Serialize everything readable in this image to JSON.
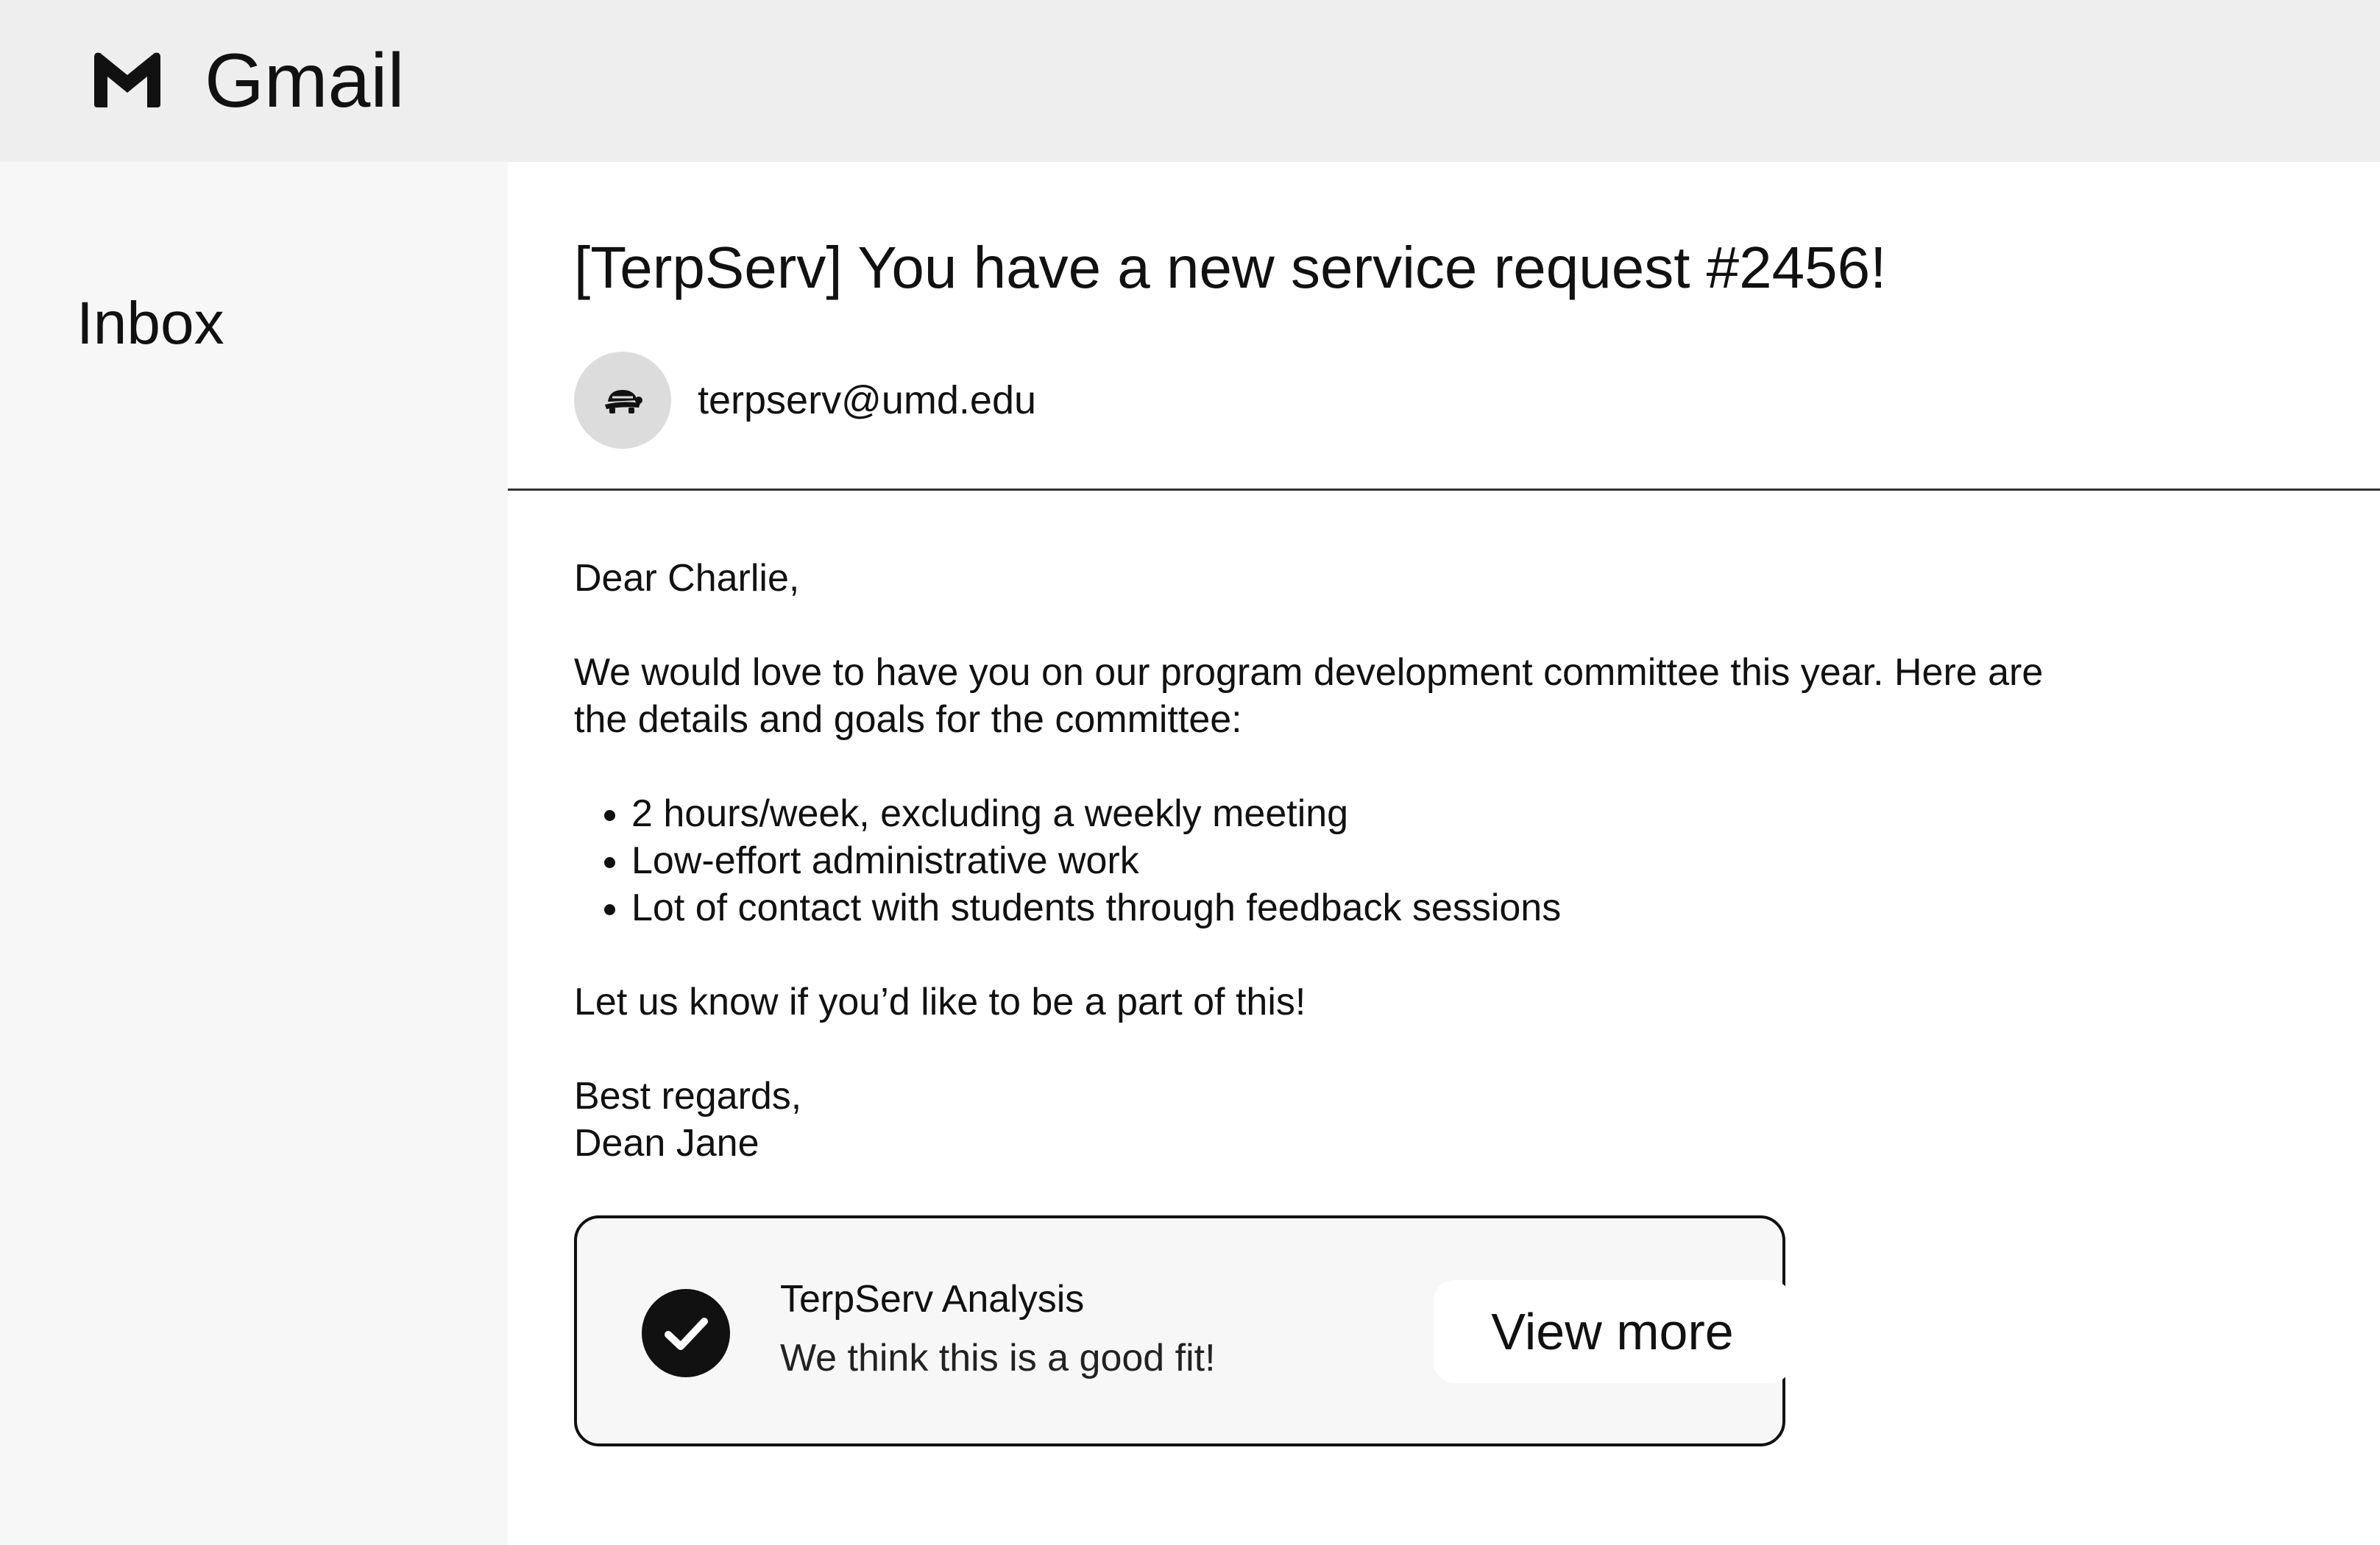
{
  "header": {
    "app_title": "Gmail",
    "logo_icon": "gmail-m-logo"
  },
  "sidebar": {
    "items": [
      {
        "label": "Inbox"
      }
    ]
  },
  "email": {
    "subject": "[TerpServ] You have a new service request #2456!",
    "sender": {
      "email": "terpserv@umd.edu",
      "avatar_icon": "terrapin-turtle"
    },
    "body": {
      "greeting": "Dear Charlie,",
      "intro_line_1": "We would love to have you on our program development committee this year. Here are",
      "intro_line_2": "the details and goals for the committee:",
      "bullets": [
        "2 hours/week, excluding a weekly meeting",
        "Low-effort administrative work",
        "Lot of contact with students through feedback sessions"
      ],
      "closing_question": "Let us know if you’d like to be a part of this!",
      "signoff": "Best regards,",
      "signature": "Dean Jane"
    },
    "analysis_card": {
      "icon": "check-circle",
      "title": "TerpServ Analysis",
      "message": "We think this is a good fit!",
      "button_label": "View more"
    }
  },
  "colors": {
    "header_bg": "#eeeeee",
    "sidebar_bg": "#f7f7f7",
    "card_bg": "#f7f7f7",
    "text": "#111111",
    "avatar_bg": "#dcdcdc"
  }
}
